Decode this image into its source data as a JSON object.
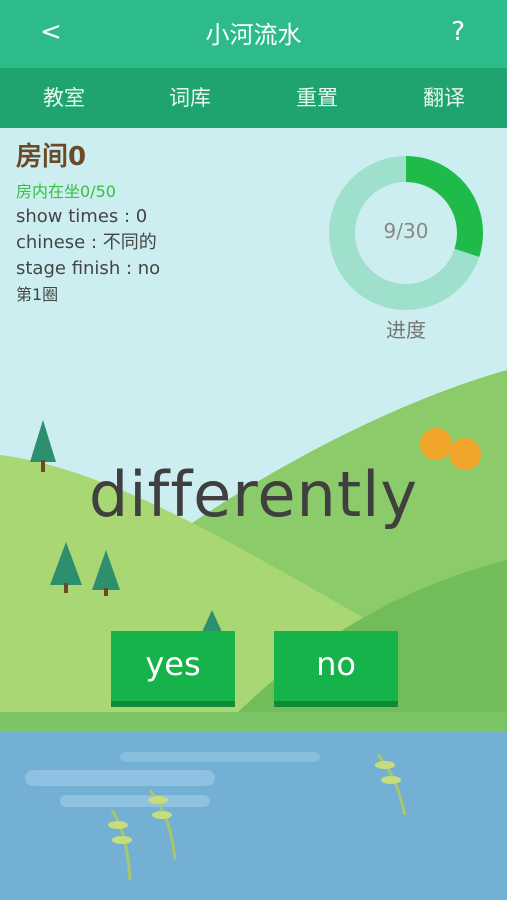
{
  "header": {
    "back_label": "<",
    "title": "小河流水",
    "help_label": "?"
  },
  "tabs": [
    {
      "label": "教室"
    },
    {
      "label": "词库"
    },
    {
      "label": "重置"
    },
    {
      "label": "翻译"
    }
  ],
  "room": {
    "title": "房间0",
    "occupancy": "房内在坐0/50",
    "show_times": "show times : 0",
    "chinese": "chinese : 不同的",
    "stage_finish": "stage finish : no",
    "round": "第1圈"
  },
  "progress": {
    "text": "9/30",
    "value": 9,
    "total": 30,
    "label": "进度",
    "color_done": "#1eba4a",
    "color_remaining": "#9fe0cc"
  },
  "word": "differently",
  "buttons": {
    "yes": "yes",
    "no": "no"
  }
}
